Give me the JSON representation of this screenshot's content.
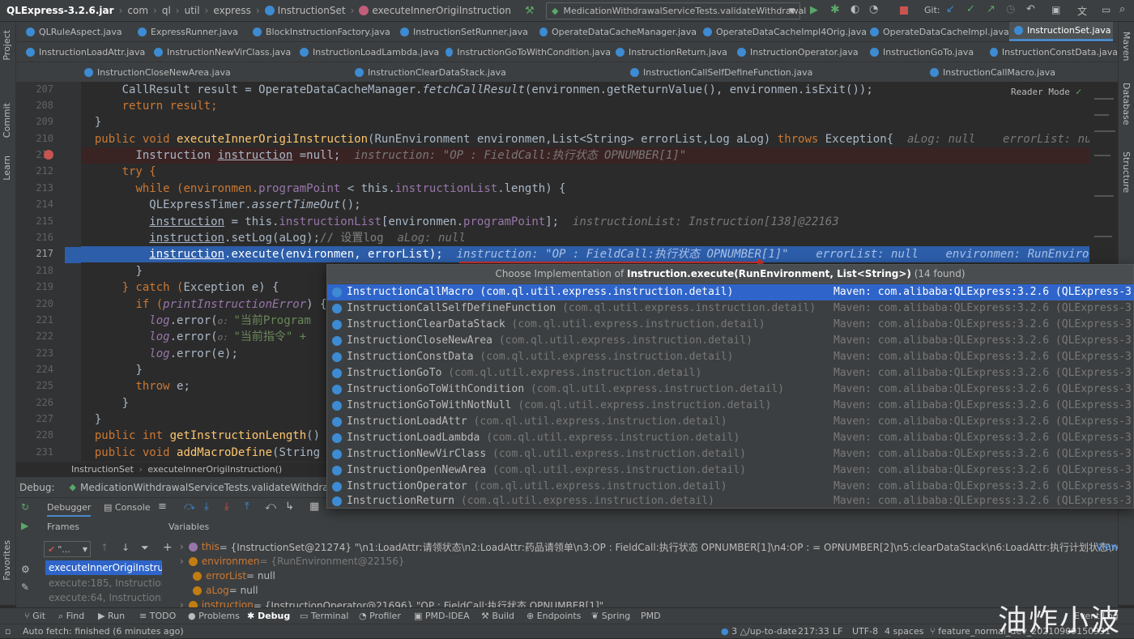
{
  "nav": {
    "project": "QLExpress-3.2.6.jar",
    "crumbs": [
      "com",
      "ql",
      "util",
      "express",
      "InstructionSet",
      "executeInnerOrigiInstruction"
    ],
    "run_config": "MedicationWithdrawalServiceTests.validateWithdrawal",
    "git_label": "Git:"
  },
  "tabs": {
    "row1": [
      "QLRuleAspect.java",
      "ExpressRunner.java",
      "BlockInstructionFactory.java",
      "InstructionSetRunner.java",
      "OperateDataCacheManager.java",
      "OperateDataCacheImpl4Orig.java",
      "OperateDataCacheImpl.java",
      "InstructionSet.java"
    ],
    "row2": [
      "InstructionLoadAttr.java",
      "InstructionNewVirClass.java",
      "InstructionLoadLambda.java",
      "InstructionGoToWithCondition.java",
      "InstructionReturn.java",
      "InstructionOperator.java",
      "InstructionGoTo.java",
      "InstructionConstData.java"
    ],
    "row3": [
      "InstructionCloseNewArea.java",
      "InstructionClearDataStack.java",
      "InstructionCallSelfDefineFunction.java",
      "InstructionCallMacro.java"
    ]
  },
  "left_toolbar": [
    "Project",
    "Commit",
    "Learn",
    "Favorites"
  ],
  "right_toolbar": [
    "Maven",
    "Database",
    "Structure"
  ],
  "editor": {
    "reader_mode": "Reader Mode",
    "line_numbers": [
      "207",
      "208",
      "209",
      "210",
      "211",
      "212",
      "213",
      "214",
      "215",
      "216",
      "217",
      "218",
      "219",
      "220",
      "221",
      "222",
      "223",
      "224",
      "225",
      "226",
      "227",
      "228",
      "231"
    ],
    "l207": "CallResult result = OperateDataCacheManager.",
    "l207b": "fetchCallResult",
    "l207c": "(environmen.getReturnValue(), environmen.isExit());",
    "l208": "return result;",
    "l210a": "public void ",
    "l210b": "executeInnerOrigiInstruction",
    "l210c": "(RunEnvironment environmen,List<String> errorList,Log aLog) ",
    "l210d": "throws ",
    "l210e": "Exception{",
    "l210hint": "aLog: null    errorList: null",
    "l211a": "Instruction ",
    "l211b": "instruction",
    "l211c": " =null;",
    "l211hint": "instruction: \"OP : FieldCall:执行状态 OPNUMBER[1]\"",
    "l212": "try {",
    "l213a": "while (environmen.",
    "l213b": "programPoint",
    "l213c": " < this.",
    "l213d": "instructionList",
    "l213e": ".length) {",
    "l214a": "QLExpressTimer.",
    "l214b": "assertTimeOut",
    "l214c": "();",
    "l215a": "instruction",
    "l215b": " = this.",
    "l215c": "instructionList",
    "l215d": "[environmen.",
    "l215e": "programPoint",
    "l215f": "];",
    "l215hint": "instructionList: Instruction[138]@22163",
    "l216a": "instruction",
    "l216b": ".setLog(aLog);",
    "l216c": "// 设置log",
    "l216hint": "aLog: null",
    "l217a": "instruction",
    "l217b": ".execute(environmen, errorList);",
    "l217hint": "instruction: \"OP : FieldCall:执行状态 OPNUMBER[1]\"    errorList: null    environmen: RunEnvironmen",
    "l218": "}",
    "l219a": "} catch (",
    "l219b": "Exception e) {",
    "l220a": "if (",
    "l220b": "printInstructionError",
    "l220c": ") {",
    "l221a": "log",
    "l221b": ".error(",
    "l221c": "o: ",
    "l221d": "\"当前Program",
    "l222a": "log",
    "l222b": ".error(",
    "l222c": "o: ",
    "l222d": "\"当前指令\" +",
    "l223a": "log",
    "l223b": ".error(e);",
    "l224": "}",
    "l225a": "throw ",
    "l225b": "e;",
    "l226": "}",
    "l227": "}",
    "l228a": "public int ",
    "l228b": "getInstructionLength",
    "l228c": "() { re",
    "l231a": "public void ",
    "l231b": "addMacroDefine",
    "l231c": "(String macr"
  },
  "editor_crumb": [
    "InstructionSet",
    "executeInnerOrigiInstruction()"
  ],
  "popup": {
    "title_prefix": "Choose Implementation of ",
    "title_sig": "Instruction.execute(RunEnvironment, List<String>)",
    "title_suffix": " (14 found)",
    "items": [
      {
        "name": "InstructionCallMacro",
        "pkg": "(com.ql.util.express.instruction.detail)",
        "maven": "Maven: com.alibaba:QLExpress:3.2.6 (QLExpress-3"
      },
      {
        "name": "InstructionCallSelfDefineFunction",
        "pkg": "(com.ql.util.express.instruction.detail)",
        "maven": "Maven: com.alibaba:QLExpress:3.2.6 (QLExpress-3"
      },
      {
        "name": "InstructionClearDataStack",
        "pkg": "(com.ql.util.express.instruction.detail)",
        "maven": "Maven: com.alibaba:QLExpress:3.2.6 (QLExpress-3"
      },
      {
        "name": "InstructionCloseNewArea",
        "pkg": "(com.ql.util.express.instruction.detail)",
        "maven": "Maven: com.alibaba:QLExpress:3.2.6 (QLExpress-3"
      },
      {
        "name": "InstructionConstData",
        "pkg": "(com.ql.util.express.instruction.detail)",
        "maven": "Maven: com.alibaba:QLExpress:3.2.6 (QLExpress-3"
      },
      {
        "name": "InstructionGoTo",
        "pkg": "(com.ql.util.express.instruction.detail)",
        "maven": "Maven: com.alibaba:QLExpress:3.2.6 (QLExpress-3"
      },
      {
        "name": "InstructionGoToWithCondition",
        "pkg": "(com.ql.util.express.instruction.detail)",
        "maven": "Maven: com.alibaba:QLExpress:3.2.6 (QLExpress-3"
      },
      {
        "name": "InstructionGoToWithNotNull",
        "pkg": "(com.ql.util.express.instruction.detail)",
        "maven": "Maven: com.alibaba:QLExpress:3.2.6 (QLExpress-3"
      },
      {
        "name": "InstructionLoadAttr",
        "pkg": "(com.ql.util.express.instruction.detail)",
        "maven": "Maven: com.alibaba:QLExpress:3.2.6 (QLExpress-3"
      },
      {
        "name": "InstructionLoadLambda",
        "pkg": "(com.ql.util.express.instruction.detail)",
        "maven": "Maven: com.alibaba:QLExpress:3.2.6 (QLExpress-3"
      },
      {
        "name": "InstructionNewVirClass",
        "pkg": "(com.ql.util.express.instruction.detail)",
        "maven": "Maven: com.alibaba:QLExpress:3.2.6 (QLExpress-3"
      },
      {
        "name": "InstructionOpenNewArea",
        "pkg": "(com.ql.util.express.instruction.detail)",
        "maven": "Maven: com.alibaba:QLExpress:3.2.6 (QLExpress-3"
      },
      {
        "name": "InstructionOperator",
        "pkg": "(com.ql.util.express.instruction.detail)",
        "maven": "Maven: com.alibaba:QLExpress:3.2.6 (QLExpress-3"
      },
      {
        "name": "InstructionReturn",
        "pkg": "(com.ql.util.express.instruction.detail)",
        "maven": "Maven: com.alibaba:QLExpress:3.2.6 (QLExpress-3"
      }
    ]
  },
  "debug": {
    "label": "Debug:",
    "session": "MedicationWithdrawalServiceTests.validateWithdrawal",
    "debugger_tab": "Debugger",
    "console_tab": "Console",
    "frames_label": "Frames",
    "variables_label": "Variables",
    "thread_label": "\"...",
    "frames": [
      "executeInnerOrigiInstruct",
      "execute:185, InstructionSe",
      "execute:64, InstructionSe"
    ],
    "vars": [
      {
        "name": "this",
        "value": " = {InstructionSet@21274} \"\\n1:LoadAttr:请领状态\\n2:LoadAttr:药品请领单\\n3:OP : FieldCall:执行状态 OPNUMBER[1]\\n4:OP : = OPNUMBER[2]\\n5:clearDataStack\\n6:LoadAttr:执行计划状态\\n7:LoadAttr:扎"
      },
      {
        "name": "environmen",
        "value": " = {RunEnvironment@22156}"
      },
      {
        "name": "errorList",
        "value": " = null"
      },
      {
        "name": "aLog",
        "value": " = null"
      },
      {
        "name": "instruction",
        "value": " = {InstructionOperator@21696} \"OP : FieldCall:执行状态 OPNUMBER[1]\""
      }
    ],
    "view_link": "View"
  },
  "bottom_tools": [
    "Git",
    "Find",
    "Run",
    "TODO",
    "Problems",
    "Debug",
    "Terminal",
    "Profiler",
    "PMD-IDEA",
    "Build",
    "Endpoints",
    "Spring",
    "PMD"
  ],
  "event_log": "Event Log",
  "status": {
    "left": "Auto fetch: finished (6 minutes ago)",
    "vcs": "3 △/up-to-date",
    "position": "217:33",
    "line_sep": "LF",
    "encoding": "UTF-8",
    "indent": "4 spaces",
    "branch": "feature_normal_dev_20210909150931"
  },
  "watermark": "油炸小波"
}
